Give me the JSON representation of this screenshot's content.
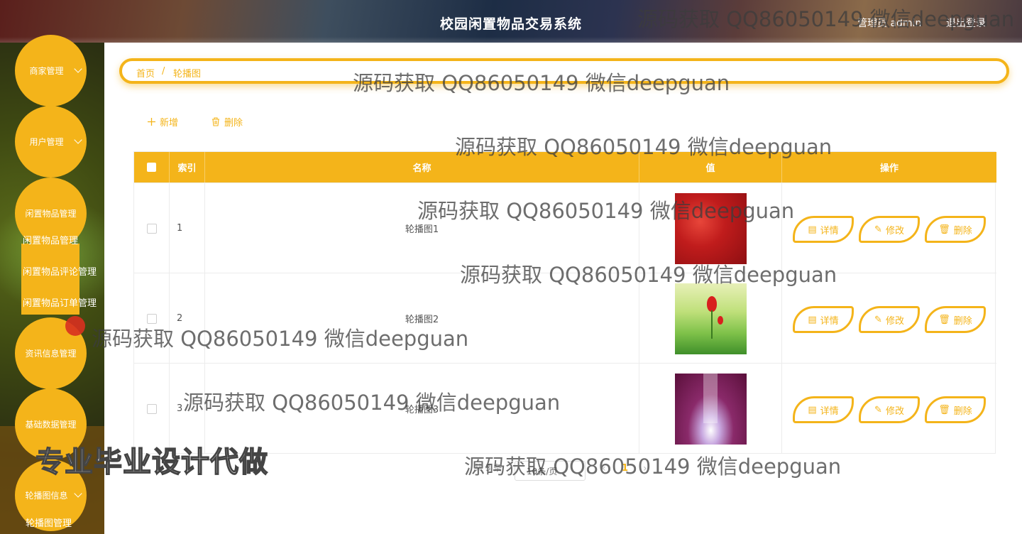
{
  "header": {
    "title": "校园闲置物品交易系统",
    "user": "管理员 admin",
    "logout": "退出登录"
  },
  "sidebar": {
    "menus": [
      {
        "label": "商家管理"
      },
      {
        "label": "用户管理"
      },
      {
        "label": "闲置物品管理"
      },
      {
        "label": "资讯信息管理"
      },
      {
        "label": "基础数据管理"
      },
      {
        "label": "轮播图信息"
      }
    ],
    "submenu_goods": [
      "闲置物品管理",
      "闲置物品评论管理",
      "闲置物品订单管理"
    ],
    "submenu_banner": [
      "轮播图管理"
    ]
  },
  "breadcrumb": {
    "home": "首页",
    "separator": "/",
    "current": "轮播图"
  },
  "toolbar": {
    "add": "新增",
    "delete": "删除"
  },
  "table": {
    "columns": [
      "索引",
      "名称",
      "值",
      "操作"
    ],
    "rows": [
      {
        "index": "1",
        "name": "轮播图1",
        "image": "red-banner"
      },
      {
        "index": "2",
        "name": "轮播图2",
        "image": "tulip-banner"
      },
      {
        "index": "3",
        "name": "轮播图3",
        "image": "stage-banner"
      }
    ],
    "actions": {
      "detail": "详情",
      "edit": "修改",
      "delete": "删除"
    }
  },
  "pagination": {
    "total": "共 3 条",
    "page_size": "10条/页",
    "current_page": "1"
  },
  "watermarks": {
    "qq": "源码获取 QQ86050149 微信deepguan",
    "promo": "专业毕业设计代做"
  },
  "colors": {
    "accent": "#f4b41a"
  }
}
